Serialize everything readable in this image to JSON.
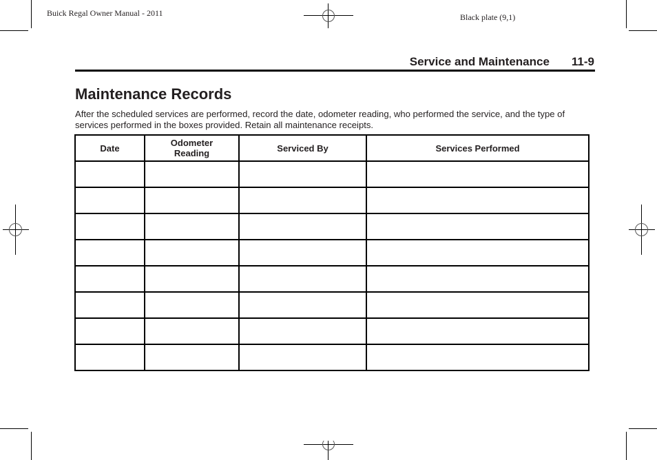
{
  "print_slug": {
    "left": "Buick Regal Owner Manual - 2011",
    "right": "Black plate (9,1)"
  },
  "running_head": {
    "section": "Service and Maintenance",
    "page_number": "11-9"
  },
  "page_title": "Maintenance Records",
  "intro_text": "After the scheduled services are performed, record the date, odometer reading, who performed the service, and the type of services performed in the boxes provided. Retain all maintenance receipts.",
  "table": {
    "columns": [
      {
        "line1": "Date",
        "line2": ""
      },
      {
        "line1": "Odometer",
        "line2": "Reading"
      },
      {
        "line1": "Serviced By",
        "line2": ""
      },
      {
        "line1": "Services Performed",
        "line2": ""
      }
    ],
    "rows": [
      [
        "",
        "",
        "",
        ""
      ],
      [
        "",
        "",
        "",
        ""
      ],
      [
        "",
        "",
        "",
        ""
      ],
      [
        "",
        "",
        "",
        ""
      ],
      [
        "",
        "",
        "",
        ""
      ],
      [
        "",
        "",
        "",
        ""
      ],
      [
        "",
        "",
        "",
        ""
      ],
      [
        "",
        "",
        "",
        ""
      ]
    ]
  },
  "icons": {
    "registration_marks": [
      "registration-target-top",
      "registration-target-left",
      "registration-target-right",
      "registration-target-bottom"
    ],
    "crop_marks": [
      "crop-mark-top-left",
      "crop-mark-top-right",
      "crop-mark-bottom-left",
      "crop-mark-bottom-right"
    ]
  }
}
